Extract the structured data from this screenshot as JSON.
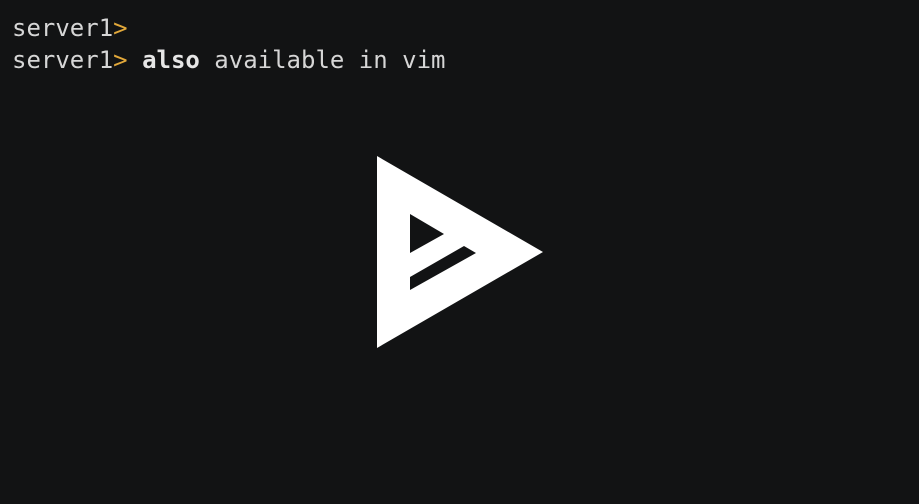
{
  "terminal": {
    "background": "#121314",
    "prompt_color": "#e2a83a",
    "lines": [
      {
        "host": "server1",
        "symbol": ">",
        "command_bold": "",
        "command_rest": ""
      },
      {
        "host": "server1",
        "symbol": ">",
        "command_bold": "also",
        "command_rest": " available in vim"
      }
    ]
  },
  "overlay": {
    "icon": "asciinema-play-icon",
    "color": "#ffffff"
  }
}
